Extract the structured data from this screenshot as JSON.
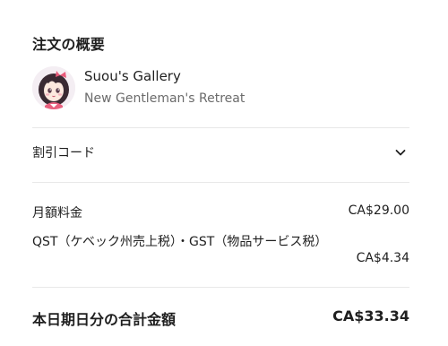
{
  "summary": {
    "title": "注文の概要"
  },
  "creator": {
    "avatar_icon": "creator-avatar-icon",
    "name": "Suou's Gallery",
    "plan": "New Gentleman's Retreat"
  },
  "coupon": {
    "label": "割引コード",
    "toggle_icon": "chevron-down-icon"
  },
  "charges": {
    "monthly_label": "月額料金",
    "monthly_amount": "CA$29.00",
    "tax_label": "QST（ケベック州売上税）・GST（物品サービス税）",
    "tax_amount": "CA$4.34"
  },
  "total": {
    "label": "本日期日分の合計金額",
    "amount": "CA$33.34"
  },
  "colors": {
    "text": "#1f1f1f",
    "muted": "#6b6b6b",
    "divider": "#e8e8e8"
  }
}
